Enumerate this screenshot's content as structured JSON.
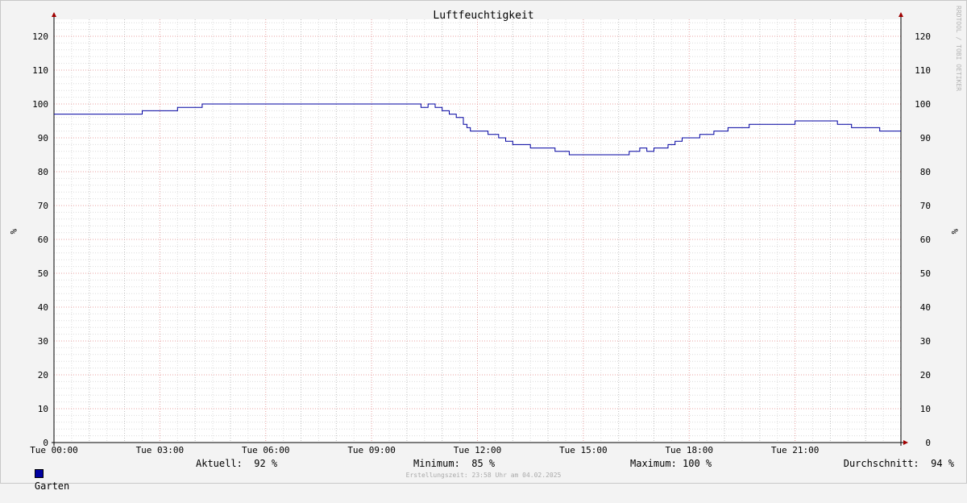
{
  "chart_data": {
    "type": "line",
    "title": "Luftfeuchtigkeit",
    "ylabel": "%",
    "ylim": [
      0,
      125
    ],
    "yticks": [
      0,
      10,
      20,
      30,
      40,
      50,
      60,
      70,
      80,
      90,
      100,
      110,
      120
    ],
    "xlim": [
      0,
      24
    ],
    "xticks": [
      {
        "value": 0,
        "label": "Tue 00:00"
      },
      {
        "value": 3,
        "label": "Tue 03:00"
      },
      {
        "value": 6,
        "label": "Tue 06:00"
      },
      {
        "value": 9,
        "label": "Tue 09:00"
      },
      {
        "value": 12,
        "label": "Tue 12:00"
      },
      {
        "value": 15,
        "label": "Tue 15:00"
      },
      {
        "value": 18,
        "label": "Tue 18:00"
      },
      {
        "value": 21,
        "label": "Tue 21:00"
      }
    ],
    "grid": true,
    "series": [
      {
        "name": "Garten",
        "color": "#0000a0",
        "x": [
          0,
          2.5,
          3.5,
          4.2,
          10.4,
          10.6,
          10.8,
          11.0,
          11.2,
          11.4,
          11.6,
          11.7,
          11.8,
          11.9,
          12.0,
          12.3,
          12.6,
          12.8,
          13.0,
          13.5,
          14.2,
          14.6,
          15.5,
          16.3,
          16.6,
          16.8,
          17.0,
          17.2,
          17.4,
          17.6,
          17.8,
          18.3,
          18.7,
          19.1,
          19.7,
          20.5,
          21.0,
          22.2,
          22.6,
          23.4,
          24.0
        ],
        "y": [
          97,
          98,
          99,
          100,
          99,
          100,
          99,
          98,
          97,
          96,
          94,
          93,
          92,
          92,
          92,
          91,
          90,
          89,
          88,
          87,
          86,
          85,
          85,
          86,
          87,
          86,
          87,
          87,
          88,
          89,
          90,
          91,
          92,
          93,
          94,
          94,
          95,
          94,
          93,
          92,
          92
        ]
      }
    ]
  },
  "legend": {
    "series_name": "Garten",
    "aktuell": "Aktuell:  92 %",
    "minimum": "Minimum:  85 %",
    "maximum": "Maximum: 100 %",
    "durchschnitt": "Durchschnitt:  94 %"
  },
  "watermark": "RRDTOOL / TOBI OETIKER",
  "footer": "Erstellungszeit: 23:58 Uhr am 04.02.2025"
}
